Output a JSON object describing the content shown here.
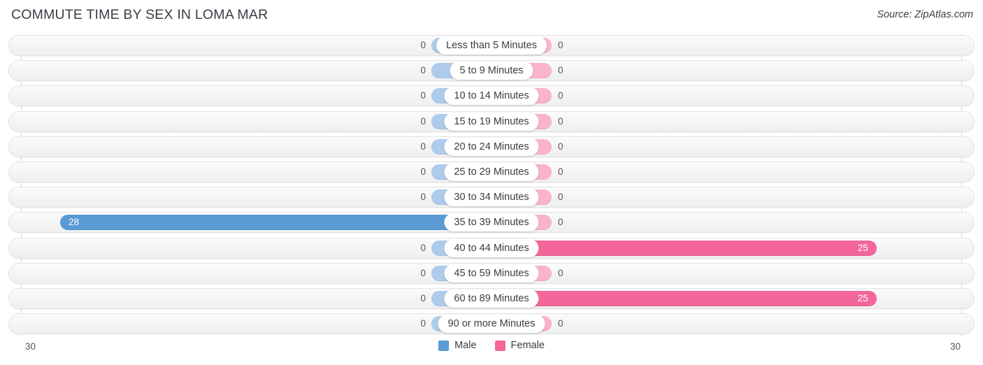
{
  "header": {
    "title": "COMMUTE TIME BY SEX IN LOMA MAR",
    "source": "Source: ZipAtlas.com"
  },
  "legend": {
    "male_label": "Male",
    "female_label": "Female",
    "male_color": "#5b9bd5",
    "female_color": "#f2669a"
  },
  "axis": {
    "left_max_label": "30",
    "right_max_label": "30"
  },
  "chart_data": {
    "type": "bar",
    "title": "COMMUTE TIME BY SEX IN LOMA MAR",
    "xlabel": "",
    "ylabel": "",
    "orientation": "horizontal-diverging",
    "xlim": [
      30,
      30
    ],
    "grid": false,
    "legend_position": "bottom-center",
    "categories": [
      "Less than 5 Minutes",
      "5 to 9 Minutes",
      "10 to 14 Minutes",
      "15 to 19 Minutes",
      "20 to 24 Minutes",
      "25 to 29 Minutes",
      "30 to 34 Minutes",
      "35 to 39 Minutes",
      "40 to 44 Minutes",
      "45 to 59 Minutes",
      "60 to 89 Minutes",
      "90 or more Minutes"
    ],
    "series": [
      {
        "name": "Male",
        "color": "#5b9bd5",
        "values": [
          0,
          0,
          0,
          0,
          0,
          0,
          0,
          28,
          0,
          0,
          0,
          0
        ]
      },
      {
        "name": "Female",
        "color": "#f2669a",
        "values": [
          0,
          0,
          0,
          0,
          0,
          0,
          0,
          0,
          25,
          0,
          25,
          0
        ]
      }
    ],
    "value_labels": {
      "male": [
        "0",
        "0",
        "0",
        "0",
        "0",
        "0",
        "0",
        "28",
        "0",
        "0",
        "0",
        "0"
      ],
      "female": [
        "0",
        "0",
        "0",
        "0",
        "0",
        "0",
        "0",
        "0",
        "25",
        "0",
        "25",
        "0"
      ]
    }
  }
}
